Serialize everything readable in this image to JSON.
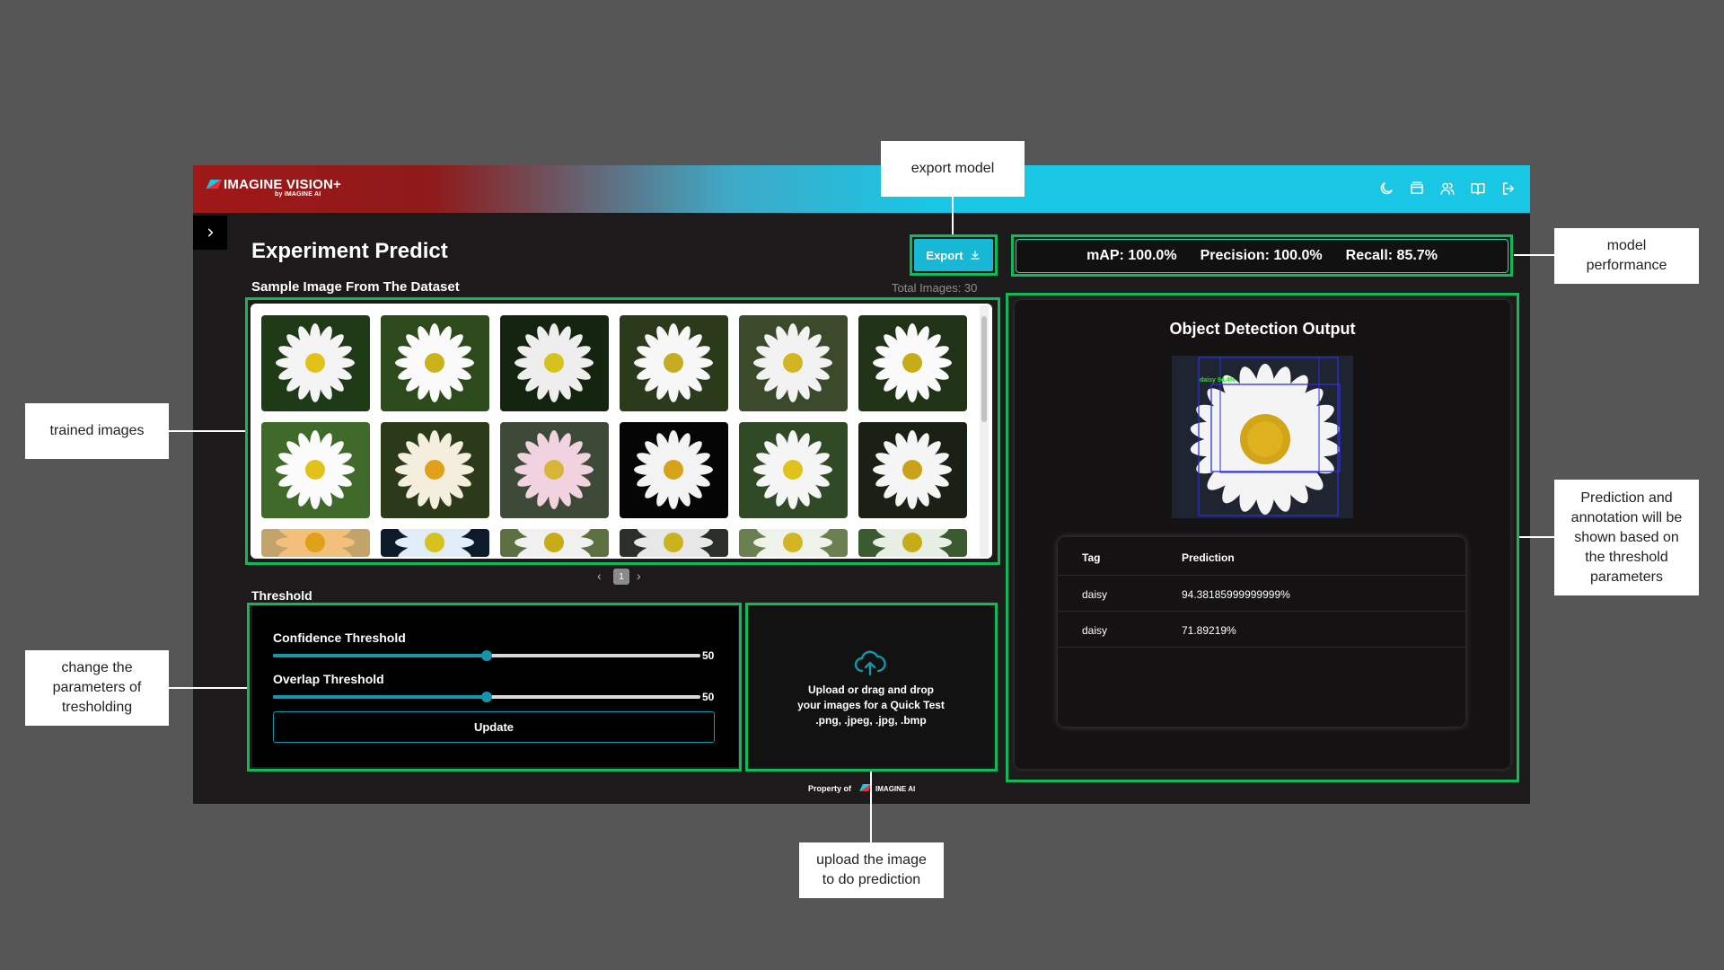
{
  "header": {
    "brand": "IMAGINE VISION+",
    "brand_sub": "by IMAGINE AI",
    "icons": [
      "moon-icon",
      "window-icon",
      "users-icon",
      "book-icon",
      "logout-icon"
    ]
  },
  "page": {
    "title": "Experiment Predict",
    "export_label": "Export",
    "metrics": {
      "map": "mAP: 100.0%",
      "precision": "Precision: 100.0%",
      "recall": "Recall: 85.7%"
    }
  },
  "dataset": {
    "section_title": "Sample Image From The Dataset",
    "total": "Total Images: 30",
    "page": "1",
    "thumbnail_count": 18
  },
  "threshold": {
    "section_title": "Threshold",
    "confidence_label": "Confidence Threshold",
    "confidence_value": "50",
    "confidence_fraction": 0.5,
    "overlap_label": "Overlap Threshold",
    "overlap_value": "50",
    "overlap_fraction": 0.5,
    "update_label": "Update"
  },
  "upload": {
    "line1": "Upload or drag and drop",
    "line2": "your images for a Quick Test",
    "line3": ".png, .jpeg, .jpg, .bmp"
  },
  "output": {
    "title": "Object Detection Output",
    "detection_label": "daisy  94.4%",
    "columns": {
      "tag": "Tag",
      "prediction": "Prediction"
    },
    "rows": [
      {
        "tag": "daisy",
        "prediction": "94.38185999999999%"
      },
      {
        "tag": "daisy",
        "prediction": "71.89219%"
      }
    ]
  },
  "footer": {
    "text": "Property of",
    "brand": "IMAGINE AI"
  },
  "annotations": {
    "export": "export model",
    "performance_1": "model",
    "performance_2": "performance",
    "trained": "trained images",
    "threshold_1": "change the",
    "threshold_2": "parameters of",
    "threshold_3": "tresholding",
    "prediction_1": "Prediction and",
    "prediction_2": "annotation will be",
    "prediction_3": "shown based on",
    "prediction_4": "the threshold",
    "prediction_5": "parameters",
    "upload_1": "upload the image",
    "upload_2": "to do prediction"
  },
  "colors": {
    "accent": "#17b7d6",
    "highlight": "#10b858",
    "slider": "#1596a9"
  }
}
